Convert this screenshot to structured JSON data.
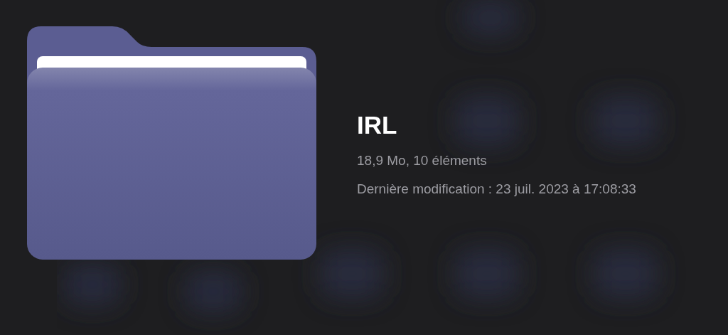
{
  "folder": {
    "name": "IRL",
    "details": "18,9 Mo, 10 éléments",
    "modified": "Dernière modification : 23 juil. 2023 à 17:08:33"
  }
}
